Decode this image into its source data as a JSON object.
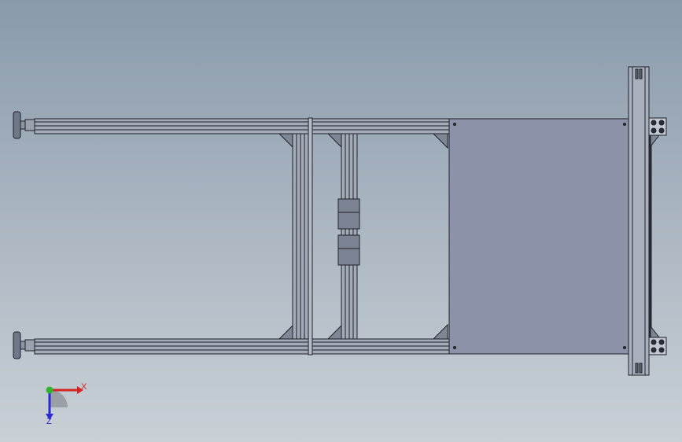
{
  "viewport": {
    "background_top": "#8a9aab",
    "background_bottom": "#c9d0d6"
  },
  "model": {
    "profile_color": "#a3abb9",
    "profile_shade": "#7f8796",
    "plate_color": "#8c93a8",
    "outline_color": "#1e2128",
    "foot_color": "#6f7888"
  },
  "triad": {
    "x_label": "X",
    "z_label": "Z",
    "x_color": "#d42424",
    "y_color": "#2fb52f",
    "z_color": "#2a2ad6"
  }
}
